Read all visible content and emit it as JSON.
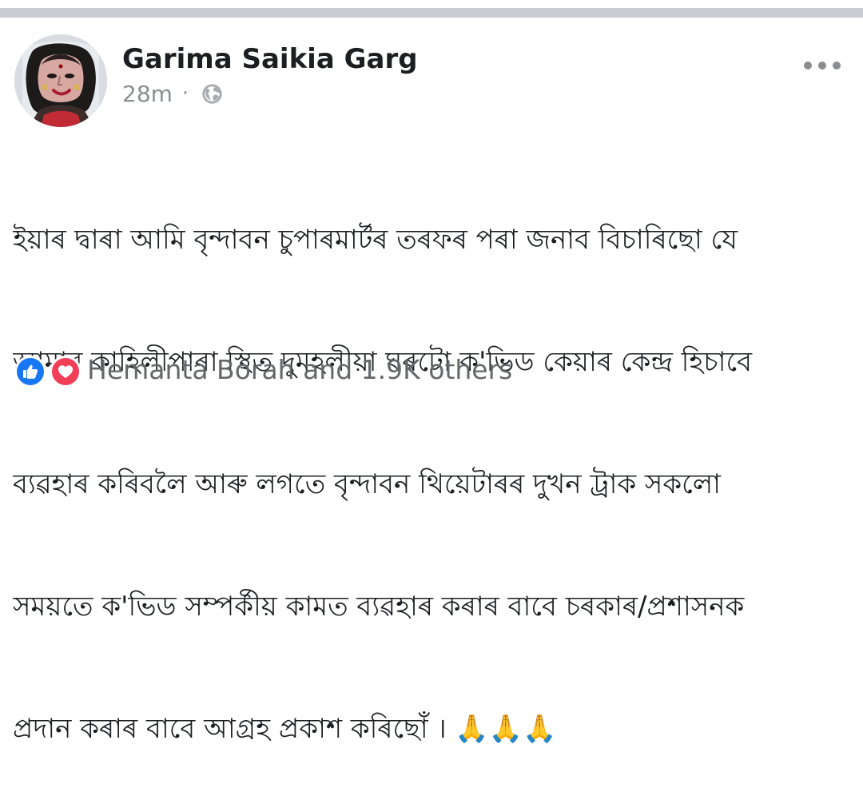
{
  "post": {
    "author_name": "Garima Saikia Garg",
    "timestamp": "28m",
    "separator": "·",
    "privacy_icon": "globe-icon",
    "more_icon": "more-options-icon",
    "body_lines": [
      "ইয়াৰ দ্বাৰা আমি বৃন্দাবন চুপাৰমাৰ্টৰ তৰফৰ পৰা জনাব  বিচাৰিছো যে",
      "আমাৰ কাহিলীপাৰা স্থিত দুমহলীয়া ঘৰটো ক'ভিড কেয়াৰ কেন্দ্ৰ হিচাবে",
      "ব্যৱহাৰ কৰিবলৈ আৰু লগতে বৃন্দাবন থিয়েটাৰৰ দুখন ট্ৰাক সকলো",
      "সময়তে ক'ভিড সম্পৰ্কীয় কামত ব্যৱহাৰ কৰাৰ বাবে চৰকাৰ/প্ৰশাসনক",
      "প্ৰদান কৰাৰ বাবে আগ্ৰহ প্ৰকাশ কৰিছোঁ । 🙏🙏🙏"
    ]
  },
  "reactions": {
    "like_icon": "thumbs-up-icon",
    "love_icon": "heart-icon",
    "summary": "Hemanta Borah and 1.9K others",
    "colors": {
      "like": "#1877f2",
      "love": "#f33e58",
      "muted_text": "#65676b",
      "meta_text": "#8a8d91",
      "divider": "#c9ccd1"
    }
  }
}
